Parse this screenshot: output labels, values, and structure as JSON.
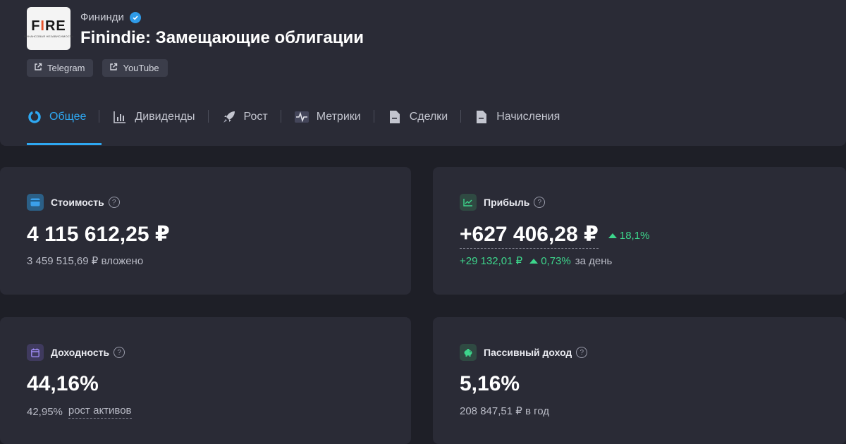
{
  "header": {
    "logo": {
      "text_main": "FIRE",
      "text_sub": "ФИНАНСОВАЯ НЕЗАВИСИМОСТЬ"
    },
    "author": "Фининди",
    "title": "Finindie: Замещающие облигации",
    "links": [
      {
        "label": "Telegram",
        "icon": "external-link-icon"
      },
      {
        "label": "YouTube",
        "icon": "external-link-icon"
      }
    ]
  },
  "tabs": [
    {
      "label": "Общее",
      "icon": "donut-icon",
      "active": true
    },
    {
      "label": "Дивиденды",
      "icon": "bar-chart-icon"
    },
    {
      "label": "Рост",
      "icon": "rocket-icon"
    },
    {
      "label": "Метрики",
      "icon": "pulse-icon"
    },
    {
      "label": "Сделки",
      "icon": "document-icon"
    },
    {
      "label": "Начисления",
      "icon": "document-icon"
    }
  ],
  "cards": {
    "value": {
      "title": "Стоимость",
      "amount": "4 115 612,25 ₽",
      "invested": "3 459 515,69 ₽ вложено"
    },
    "profit": {
      "title": "Прибыль",
      "amount": "+627 406,28 ₽",
      "percent": "18,1%",
      "day_amount": "+29 132,01 ₽",
      "day_percent": "0,73%",
      "day_suffix": "за день"
    },
    "yield": {
      "title": "Доходность",
      "amount": "44,16%",
      "growth_value": "42,95%",
      "growth_label": "рост активов"
    },
    "passive": {
      "title": "Пассивный доход",
      "amount": "5,16%",
      "per_year": "208 847,51 ₽ в год"
    }
  },
  "colors": {
    "accent": "#2ea8f2",
    "positive": "#3dd68c",
    "background": "#1e1f27",
    "card": "#2a2b36"
  }
}
